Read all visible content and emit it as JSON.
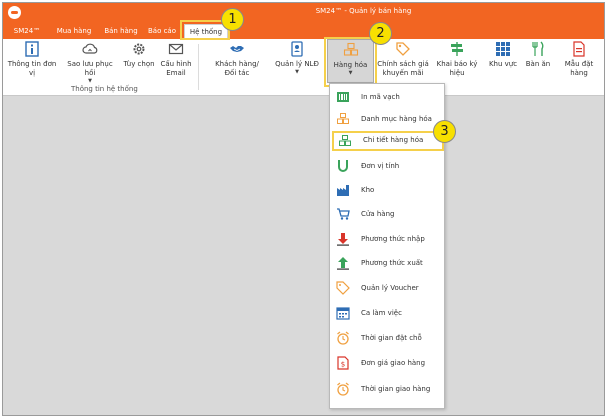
{
  "window": {
    "title": "SM24™ - Quản lý bán hàng"
  },
  "tabs": [
    {
      "label": "SM24™"
    },
    {
      "label": "Mua hàng"
    },
    {
      "label": "Bán hàng"
    },
    {
      "label": "Báo cáo"
    },
    {
      "label": "Hệ thống"
    }
  ],
  "ribbon": {
    "buttons": [
      {
        "label": "Thông tin đơn vị",
        "icon": "info-icon"
      },
      {
        "label": "Sao lưu phục hồi",
        "icon": "cloud-sync-icon"
      },
      {
        "label": "Tùy chọn",
        "icon": "gear-icon"
      },
      {
        "label": "Cấu hình\nEmail",
        "icon": "envelope-icon"
      },
      {
        "label": "Khách hàng/\nĐối tác",
        "icon": "handshake-icon"
      },
      {
        "label": "Quản lý NLĐ",
        "icon": "id-card-icon"
      },
      {
        "label": "Hàng hóa",
        "icon": "boxes-icon"
      },
      {
        "label": "Chính sách giá\nkhuyến mãi",
        "icon": "price-tag-icon"
      },
      {
        "label": "Khai báo ký hiệu",
        "icon": "signpost-icon"
      },
      {
        "label": "Khu vực",
        "icon": "grid-icon"
      },
      {
        "label": "Bàn ăn",
        "icon": "utensils-icon"
      },
      {
        "label": "Mẫu đặt hàng",
        "icon": "order-form-icon"
      }
    ],
    "group_label": "Thông tin hệ thống"
  },
  "dropdown": {
    "items": [
      {
        "label": "In mã vạch",
        "icon": "barcode-icon"
      },
      {
        "label": "Danh mục hàng hóa",
        "icon": "boxes-icon"
      },
      {
        "label": "Chi tiết hàng hóa",
        "icon": "boxes-detail-icon"
      },
      {
        "label": "Đơn vị tính",
        "icon": "unit-icon"
      },
      {
        "label": "Kho",
        "icon": "warehouse-icon"
      },
      {
        "label": "Cửa hàng",
        "icon": "cart-icon"
      },
      {
        "label": "Phương thức nhập",
        "icon": "arrow-down-icon"
      },
      {
        "label": "Phương thức xuất",
        "icon": "arrow-up-icon"
      },
      {
        "label": "Quản lý Voucher",
        "icon": "voucher-icon"
      },
      {
        "label": "Ca làm việc",
        "icon": "calendar-icon"
      },
      {
        "label": "Thời gian đặt chỗ",
        "icon": "alarm-clock-icon"
      },
      {
        "label": "Đơn giá giao hàng",
        "icon": "dollar-doc-icon"
      },
      {
        "label": "Thời gian giao hàng",
        "icon": "alarm-clock-icon"
      }
    ],
    "selected": "Chi tiết hàng hóa"
  },
  "annotations": [
    "1",
    "2",
    "3"
  ],
  "colors": {
    "brand": "#f26522",
    "highlight": "#f5d04b",
    "badge": "#f8e000",
    "icon_blue": "#2e6db4"
  }
}
